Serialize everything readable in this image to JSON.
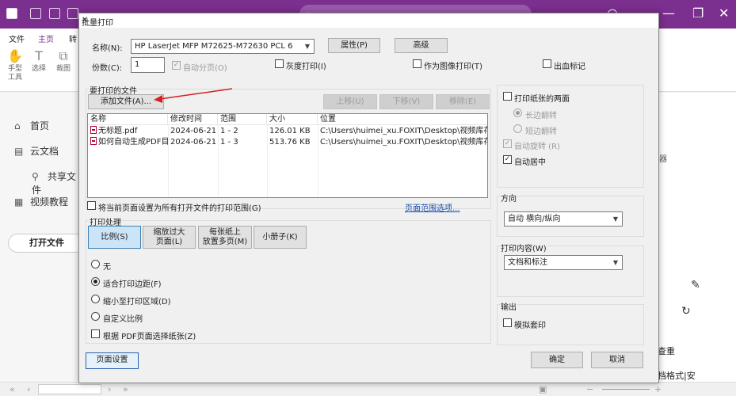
{
  "app": {
    "ribbon_tabs": [
      "文件",
      "主页",
      "转"
    ],
    "tools": [
      {
        "icon": "hand-tool-icon",
        "label": "手型\n工具"
      },
      {
        "icon": "select-tool-icon",
        "label": "选择"
      },
      {
        "icon": "crop-tool-icon",
        "label": "裁图"
      }
    ],
    "sidebar": [
      {
        "icon": "home-icon",
        "label": "首页"
      },
      {
        "icon": "cloud-doc-icon",
        "label": "云文档"
      },
      {
        "icon": "share-doc-icon",
        "label": "共享文件"
      },
      {
        "icon": "video-tutorial-icon",
        "label": "视频教程"
      }
    ],
    "open_file": "打开文件",
    "right_text": [
      "器",
      "查重",
      "档格式|安"
    ]
  },
  "dialog": {
    "title": "批量打印",
    "printer": {
      "name_label": "名称(N):",
      "value": "HP LaserJet MFP M72625-M72630 PCL 6",
      "properties": "属性(P)",
      "advanced": "高级"
    },
    "copies": {
      "label": "份数(C):",
      "value": "1",
      "collate": "自动分页(O)",
      "grayscale": "灰度打印(I)",
      "as_image": "作为图像打印(T)",
      "bleed_marks": "出血标记"
    },
    "files_group": {
      "title": "要打印的文件",
      "add": "添加文件(A)...",
      "move_up": "上移(U)",
      "move_down": "下移(V)",
      "remove": "移除(E)",
      "columns": [
        "名称",
        "修改时间",
        "范围",
        "大小",
        "位置"
      ],
      "rows": [
        [
          "无标题.pdf",
          "2024-06-21 ...",
          "1 - 2",
          "126.01 KB",
          "C:\\Users\\huimei_xu.FOXIT\\Desktop\\视频库存\\如何将..."
        ],
        [
          "如何自动生成PDF目...",
          "2024-06-21 ...",
          "1 - 3",
          "513.76 KB",
          "C:\\Users\\huimei_xu.FOXIT\\Desktop\\视频库存\\如何自..."
        ]
      ],
      "apply_all": "将当前页面设置为所有打开文件的打印范围(G)",
      "page_range_link": "页面范围选项..."
    },
    "handling": {
      "title": "打印处理",
      "tabs": [
        "比例(S)",
        "缩放过大\n页面(L)",
        "每张纸上\n放置多页(M)",
        "小册子(K)"
      ],
      "options": [
        "无",
        "适合打印边距(F)",
        "缩小至打印区域(D)",
        "自定义比例"
      ],
      "selected": 1,
      "choose_source": "根据 PDF页面选择纸张(Z)"
    },
    "duplex": {
      "label": "打印纸张的两面",
      "long_edge": "长边翻转",
      "short_edge": "短边翻转",
      "auto_rotate": "自动旋转 (R)",
      "auto_center": "自动居中"
    },
    "orientation": {
      "title": "方向",
      "value": "自动 横向/纵向"
    },
    "content": {
      "title": "打印内容(W)",
      "value": "文档和标注"
    },
    "output": {
      "title": "输出",
      "simulate_overprint": "模拟套印"
    },
    "page_setup": "页面设置",
    "ok": "确定",
    "cancel": "取消"
  }
}
